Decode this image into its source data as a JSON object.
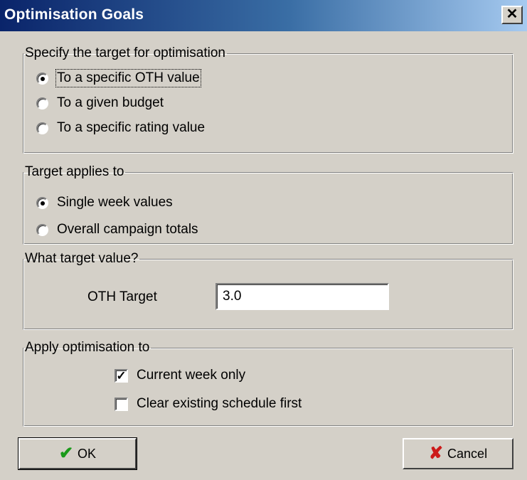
{
  "window": {
    "title": "Optimisation Goals",
    "close_icon": "close-icon"
  },
  "target_group": {
    "legend": "Specify the target for optimisation",
    "options": [
      {
        "label": "To a specific OTH value",
        "selected": true
      },
      {
        "label": "To a given budget",
        "selected": false
      },
      {
        "label": "To a specific rating value",
        "selected": false
      }
    ]
  },
  "applies_group": {
    "legend": "Target applies to",
    "options": [
      {
        "label": "Single week values",
        "selected": true
      },
      {
        "label": "Overall campaign totals",
        "selected": false
      }
    ]
  },
  "value_group": {
    "legend": "What target value?",
    "field_label": "OTH Target",
    "field_value": "3.0"
  },
  "apply_group": {
    "legend": "Apply optimisation to",
    "checks": [
      {
        "label": "Current week only",
        "checked": true
      },
      {
        "label": "Clear existing schedule first",
        "checked": false
      }
    ]
  },
  "buttons": {
    "ok_label": "OK",
    "cancel_label": "Cancel",
    "ok_icon": "check-icon",
    "cancel_icon": "x-icon",
    "ok_icon_color": "#1a9a1a",
    "cancel_icon_color": "#cc1a1a"
  }
}
